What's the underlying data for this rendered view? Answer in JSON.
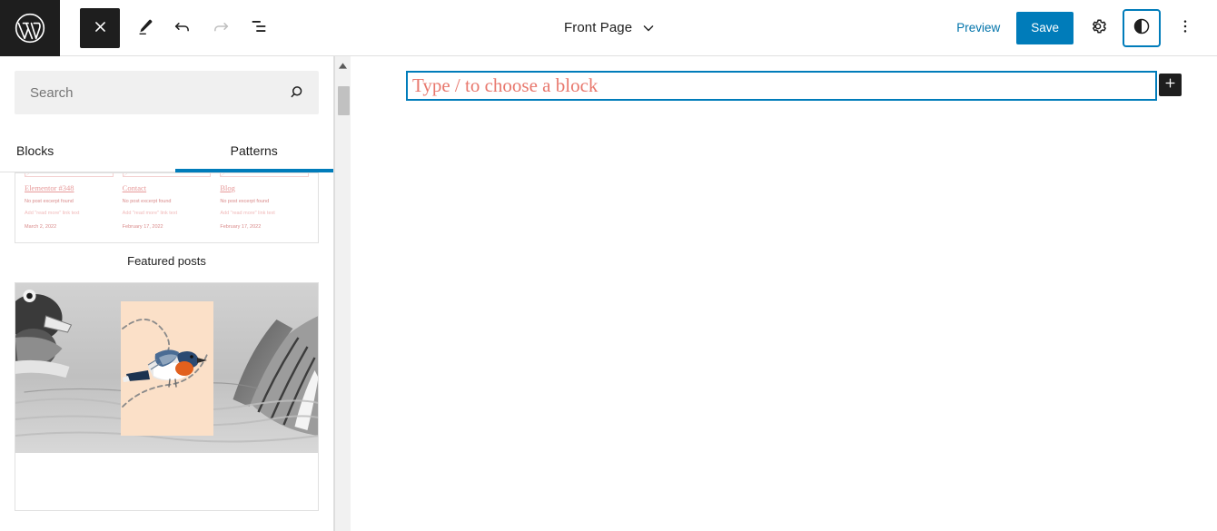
{
  "topbar": {
    "logo_icon": "wordpress-logo-icon",
    "close_label": "Close",
    "close_icon": "close-x-icon",
    "edit_icon": "pencil-edit-icon",
    "undo_icon": "undo-arrow-icon",
    "redo_icon": "redo-arrow-icon",
    "list_view_icon": "list-view-icon",
    "title": "Front Page",
    "title_chevron_icon": "chevron-down-icon",
    "preview_label": "Preview",
    "save_label": "Save",
    "settings_icon": "gear-icon",
    "styles_icon": "contrast-half-circle-icon",
    "more_icon": "more-vertical-dots-icon"
  },
  "inserter": {
    "search": {
      "placeholder": "Search",
      "value": "",
      "icon": "search-magnifier-icon"
    },
    "tabs": [
      {
        "label": "Blocks",
        "active": false
      },
      {
        "label": "Patterns",
        "active": true
      }
    ],
    "patterns": [
      {
        "name": "query-loop-pattern",
        "label": "Featured posts",
        "posts": [
          {
            "title": "Elementor #348",
            "excerpt": "No post excerpt found",
            "more": "Add \"read more\" link text",
            "date": "March 2, 2022"
          },
          {
            "title": "Contact",
            "excerpt": "No post excerpt found",
            "more": "Add \"read more\" link text",
            "date": "February 17, 2022"
          },
          {
            "title": "Blog",
            "excerpt": "No post excerpt found",
            "more": "Add \"read more\" link text",
            "date": "February 17, 2022"
          }
        ]
      },
      {
        "name": "bird-image-pattern",
        "label": ""
      }
    ],
    "scrollbar": {
      "up_arrow_icon": "scroll-up-arrow-icon",
      "thumb": "scrollbar-thumb"
    }
  },
  "canvas": {
    "block_placeholder": "Type / to choose a block",
    "add_block_icon": "plus-icon"
  },
  "colors": {
    "accent": "#007cba",
    "link": "#0073aa",
    "dark": "#1e1e1e",
    "placeholder_red": "#e8786d",
    "pattern_pink": "#e79a9a",
    "bird_panel": "#fbe0c8"
  }
}
